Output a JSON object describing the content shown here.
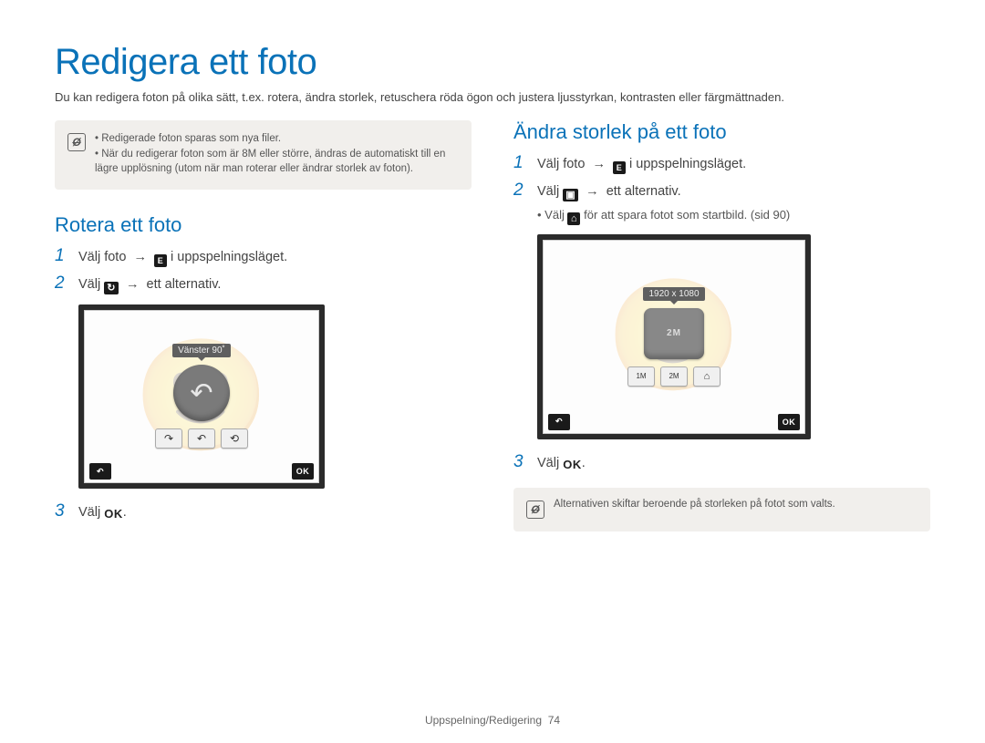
{
  "page": {
    "title": "Redigera ett foto",
    "intro": "Du kan redigera foton på olika sätt, t.ex. rotera, ändra storlek, retuschera röda ögon och justera ljusstyrkan, kontrasten eller färgmättnaden.",
    "footer_section": "Uppspelning/Redigering",
    "footer_page": "74"
  },
  "top_note": {
    "items": [
      "Redigerade foton sparas som nya filer.",
      "När du redigerar foton som är 8M eller större, ändras de automatiskt till en lägre upplösning (utom när man roterar eller ändrar storlek av foton)."
    ]
  },
  "rotate": {
    "heading": "Rotera ett foto",
    "step1_a": "Välj foto",
    "step1_b": "i uppspelningsläget.",
    "step2_a": "Välj",
    "step2_b": "ett alternativ.",
    "step3": "Välj",
    "lcd": {
      "tooltip": "Vänster 90˚",
      "back_label": "↶",
      "ok_label": "OK"
    }
  },
  "resize": {
    "heading": "Ändra storlek på ett foto",
    "step1_a": "Välj foto",
    "step1_b": "i uppspelningsläget.",
    "step2_a": "Välj",
    "step2_b": "ett alternativ.",
    "step2_sub_a": "Välj",
    "step2_sub_b": "för att spara fotot som startbild. (sid 90)",
    "step3": "Välj",
    "lcd": {
      "tooltip": "1920 x 1080",
      "knob_label": "2M",
      "back_label": "↶",
      "ok_label": "OK"
    },
    "bottom_note": "Alternativen skiftar beroende på storleken på fotot som valts."
  },
  "labels": {
    "arrow": "→",
    "ok": "OK"
  }
}
